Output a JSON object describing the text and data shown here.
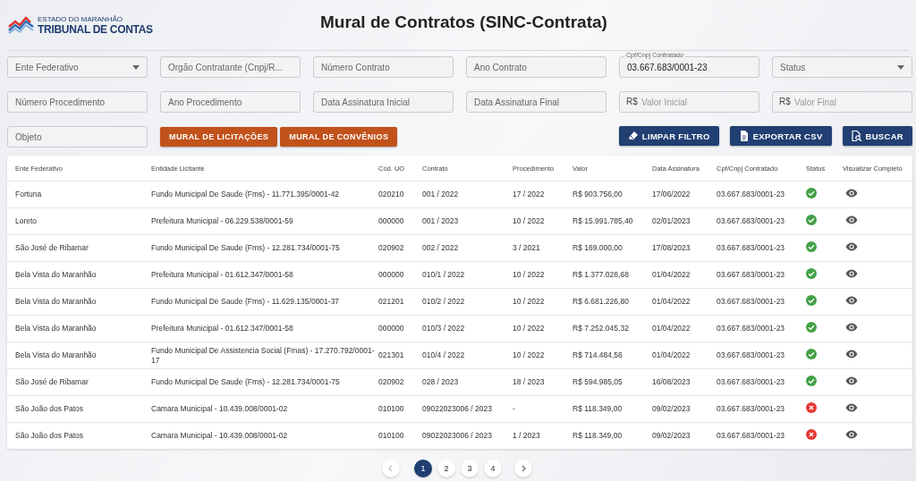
{
  "header": {
    "logo_small": "ESTADO DO MARANHÃO",
    "logo_main": "TRIBUNAL DE CONTAS",
    "title": "Mural de Contratos (SINC-Contrata)"
  },
  "filters": [
    {
      "kind": "select",
      "placeholder": "Ente Federativo"
    },
    {
      "kind": "text",
      "placeholder": "Orgão Contratante (Cnpj/R..."
    },
    {
      "kind": "text",
      "placeholder": "Número Contrato"
    },
    {
      "kind": "text",
      "placeholder": "Ano Contrato"
    },
    {
      "kind": "filled",
      "label": "Cpf/Cnpj Contratado",
      "value": "03.667.683/0001-23"
    },
    {
      "kind": "select",
      "placeholder": "Status"
    },
    {
      "kind": "text",
      "placeholder": "Número Procedimento"
    },
    {
      "kind": "text",
      "placeholder": "Ano Procedimento"
    },
    {
      "kind": "text",
      "placeholder": "Data Assinatura Inicial"
    },
    {
      "kind": "text",
      "placeholder": "Data Assinatura Final"
    },
    {
      "kind": "money",
      "prefix": "R$",
      "placeholder": "Valor Inicial"
    },
    {
      "kind": "money",
      "prefix": "R$",
      "placeholder": "Valor Final"
    },
    {
      "kind": "text",
      "placeholder": "Objeto"
    }
  ],
  "link_buttons": [
    "MURAL DE LICITAÇÕES",
    "MURAL DE CONVÊNIOS"
  ],
  "action_buttons": [
    {
      "kind": "eraser",
      "label": "LIMPAR FILTRO"
    },
    {
      "kind": "file",
      "label": "EXPORTAR CSV"
    },
    {
      "kind": "search",
      "label": "BUSCAR"
    }
  ],
  "table": {
    "columns": [
      "Ente Federativo",
      "Entidade Licitante",
      "Cód. UO",
      "Contrato",
      "Procedimento",
      "Valor",
      "Data Assinatura",
      "Cpf/Cnpj Contratado",
      "Status",
      "Visualizar Completo"
    ],
    "rows": [
      {
        "cells": [
          "Fortuna",
          "Fundo Municipal De Saude (Fms) - 11.771.395/0001-42",
          "020210",
          "001 / 2022",
          "17 / 2022",
          "R$ 903.756,00",
          "17/06/2022",
          "03.667.683/0001-23"
        ],
        "approved": true
      },
      {
        "cells": [
          "Loreto",
          "Prefeitura Municipal - 06.229.538/0001-59",
          "000000",
          "001 / 2023",
          "10 / 2022",
          "R$ 15.991.785,40",
          "02/01/2023",
          "03.667.683/0001-23"
        ],
        "approved": true
      },
      {
        "cells": [
          "São José de Ribamar",
          "Fundo Municipal De Saude (Fms) - 12.281.734/0001-75",
          "020902",
          "002 / 2022",
          "3 / 2021",
          "R$ 169.000,00",
          "17/08/2023",
          "03.667.683/0001-23"
        ],
        "approved": true
      },
      {
        "cells": [
          "Bela Vista do Maranhão",
          "Prefeitura Municipal - 01.612.347/0001-58",
          "000000",
          "010/1 / 2022",
          "10 / 2022",
          "R$ 1.377.028,68",
          "01/04/2022",
          "03.667.683/0001-23"
        ],
        "approved": true
      },
      {
        "cells": [
          "Bela Vista do Maranhão",
          "Fundo Municipal De Saude (Fms) - 11.629.135/0001-37",
          "021201",
          "010/2 / 2022",
          "10 / 2022",
          "R$ 6.681.226,80",
          "01/04/2022",
          "03.667.683/0001-23"
        ],
        "approved": true
      },
      {
        "cells": [
          "Bela Vista do Maranhão",
          "Prefeitura Municipal - 01.612.347/0001-58",
          "000000",
          "010/3 / 2022",
          "10 / 2022",
          "R$ 7.252.045,32",
          "01/04/2022",
          "03.667.683/0001-23"
        ],
        "approved": true
      },
      {
        "cells": [
          "Bela Vista do Maranhão",
          "Fundo Municipal De Assistencia Social (Fmas) - 17.270.792/0001-17",
          "021301",
          "010/4 / 2022",
          "10 / 2022",
          "R$ 714.484,56",
          "01/04/2022",
          "03.667.683/0001-23"
        ],
        "approved": true
      },
      {
        "cells": [
          "São José de Ribamar",
          "Fundo Municipal De Saude (Fms) - 12.281.734/0001-75",
          "020902",
          "028 / 2023",
          "18 / 2023",
          "R$ 594.985,05",
          "16/08/2023",
          "03.667.683/0001-23"
        ],
        "approved": true
      },
      {
        "cells": [
          "São João dos Patos",
          "Camara Municipal - 10.439.008/0001-02",
          "010100",
          "09022023006 / 2023",
          "-",
          "R$ 118.349,00",
          "09/02/2023",
          "03.667.683/0001-23"
        ],
        "approved": false
      },
      {
        "cells": [
          "São João dos Patos",
          "Camara Municipal - 10.439.008/0001-02",
          "010100",
          "09022023006 / 2023",
          "1 / 2023",
          "R$ 118.349,00",
          "09/02/2023",
          "03.667.683/0001-23"
        ],
        "approved": false
      }
    ]
  },
  "pagination": {
    "pages": [
      {
        "label": "1",
        "selected": true
      },
      {
        "label": "2",
        "selected": false
      },
      {
        "label": "3",
        "selected": false
      },
      {
        "label": "4",
        "selected": false
      }
    ]
  }
}
